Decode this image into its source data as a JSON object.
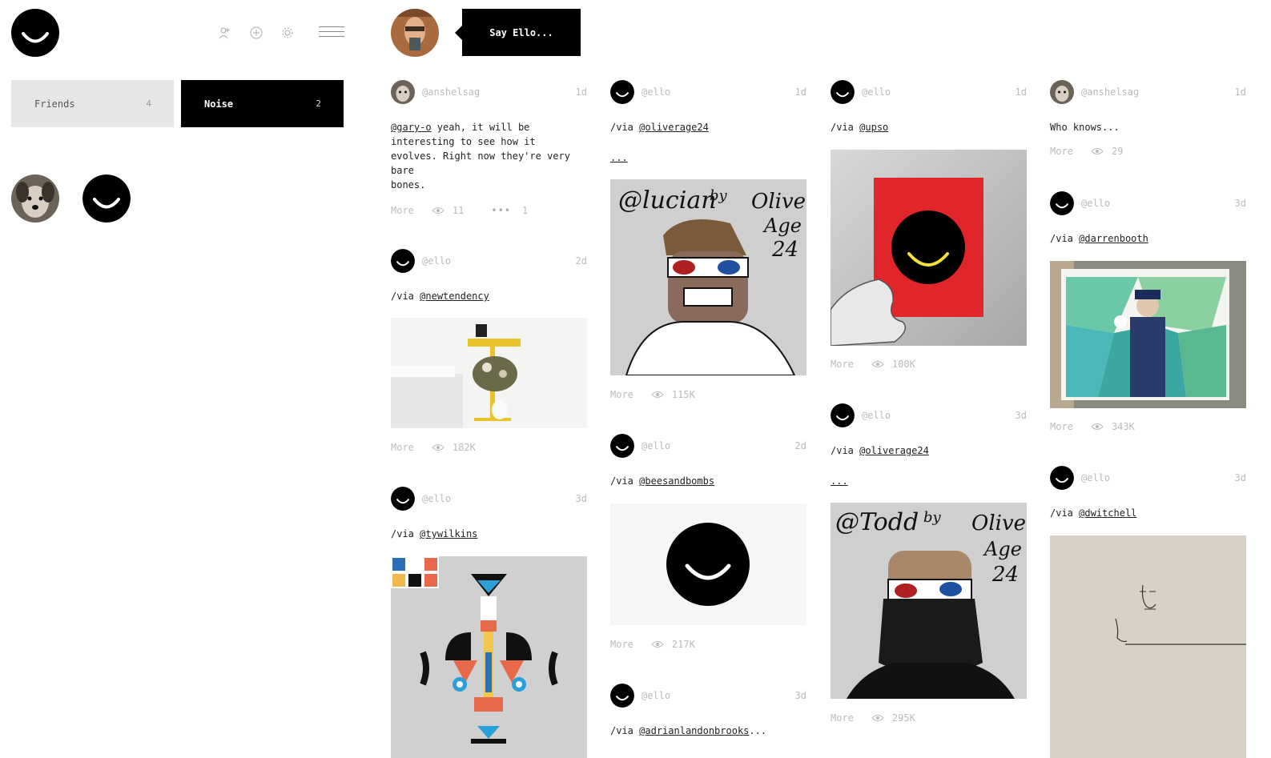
{
  "sidebar": {
    "tabs": [
      {
        "label": "Friends",
        "count": "4"
      },
      {
        "label": "Noise",
        "count": "2"
      }
    ]
  },
  "omnibar": {
    "say_label": "Say Ello..."
  },
  "posts": [
    {
      "user": "@anshelsag",
      "time": "1d",
      "mention": "@gary-o",
      "text": " yeah, it will be interesting to see how it evolves. Right now they're very bare",
      "text2": "bones.",
      "more": "More",
      "views": "11",
      "comments": "1"
    },
    {
      "user": "@ello",
      "time": "2d",
      "via": "/via",
      "mention": "@newtendency",
      "more": "More",
      "views": "182K"
    },
    {
      "user": "@ello",
      "time": "3d",
      "via": "/via",
      "mention": "@tywilkins"
    },
    {
      "user": "@ello",
      "time": "1d",
      "via": "/via",
      "mention": "@oliverage24",
      "ellipsis": "...",
      "img_text": {
        "handle": "@lucian",
        "by": "by",
        "name": "Oliver",
        "age": "Age",
        "num": "24"
      },
      "more": "More",
      "views": "115K"
    },
    {
      "user": "@ello",
      "time": "2d",
      "via": "/via",
      "mention": "@beesandbombs",
      "more": "More",
      "views": "217K"
    },
    {
      "user": "@ello",
      "time": "3d",
      "via": "/via",
      "mention": "@adrianlandonbrooks",
      "tail": "..."
    },
    {
      "user": "@ello",
      "time": "1d",
      "via": "/via",
      "mention": "@upso",
      "more": "More",
      "views": "100K"
    },
    {
      "user": "@ello",
      "time": "3d",
      "via": "/via",
      "mention": "@oliverage24",
      "ellipsis": "...",
      "img_text": {
        "handle": "@Todd",
        "by": "by",
        "name": "Oliver",
        "age": "Age",
        "num": "24"
      },
      "more": "More",
      "views": "295K"
    },
    {
      "user": "@anshelsag",
      "time": "1d",
      "text": "Who knows...",
      "more": "More",
      "views": "29"
    },
    {
      "user": "@ello",
      "time": "3d",
      "via": "/via",
      "mention": "@darrenbooth",
      "more": "More",
      "views": "343K"
    },
    {
      "user": "@ello",
      "time": "3d",
      "via": "/via",
      "mention": "@dwitchell"
    }
  ]
}
